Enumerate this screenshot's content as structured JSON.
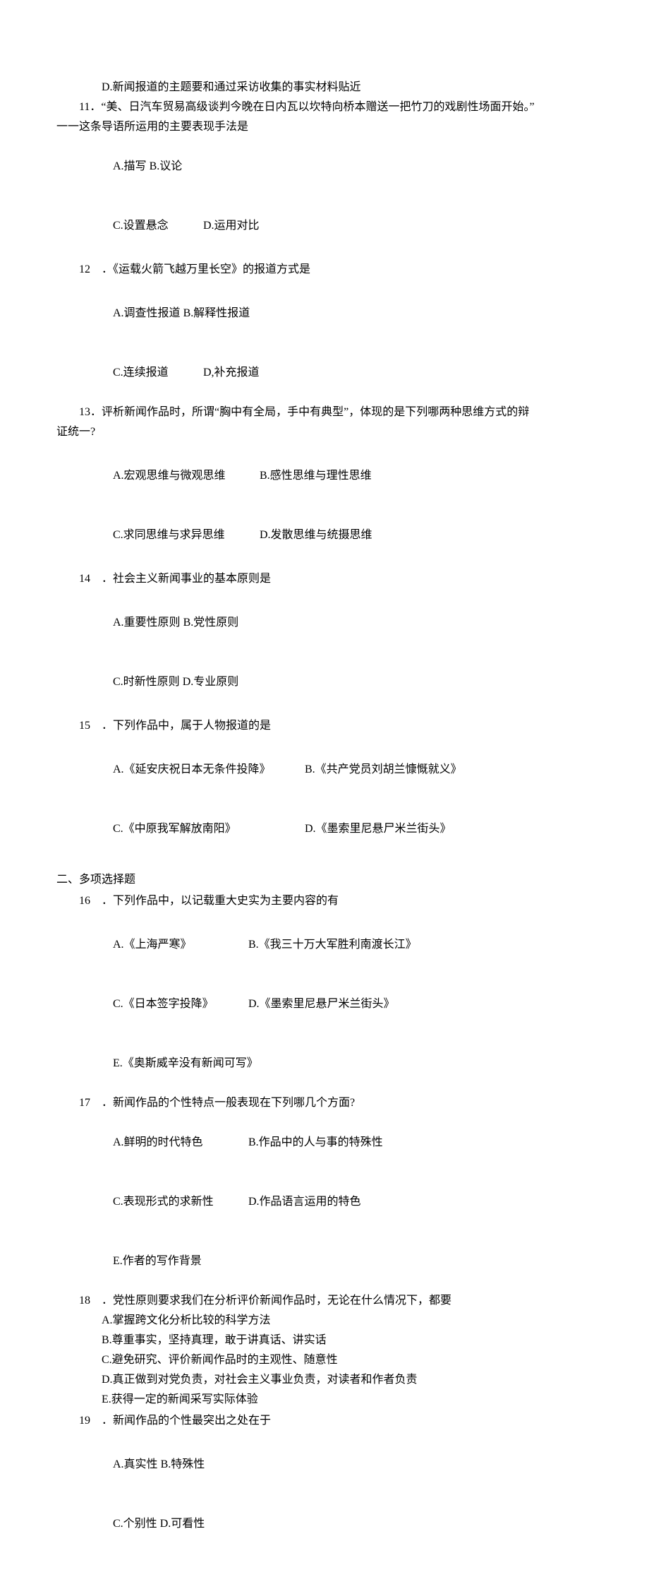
{
  "q10": {
    "optD": "D.新闻报道的主题要和通过采访收集的事实材料贴近"
  },
  "q11": {
    "num": "11",
    "stem": "．“美、日汽车贸易高级谈判今晚在日内瓦以坎特向桥本赠送一把竹刀的戏剧性场面开始。”",
    "stem2": "一一这条导语所运用的主要表现手法是",
    "optA": "A.描写",
    "optB": "B.议论",
    "optC": "C.设置悬念",
    "optD": "D.运用对比"
  },
  "q12": {
    "num": "12",
    "stem": "．《运载火箭飞越万里长空》的报道方式是",
    "optA": "A.调查性报道",
    "optB": "B.解释性报道",
    "optC": "C.连续报道",
    "optD": "D,补充报道"
  },
  "q13": {
    "num": "13",
    "stem": "．评析新闻作品时，所谓“胸中有全局，手中有典型”，体现的是下列哪两种思维方式的辩",
    "stem2": "证统一?",
    "optA": "A.宏观思维与微观思维",
    "optB": "B.感性思维与理性思维",
    "optC": "C.求同思维与求异思维",
    "optD": "D.发散思维与统摄思维"
  },
  "q14": {
    "num": "14",
    "stem": "．社会主义新闻事业的基本原则是",
    "optA": "A.重要性原则",
    "optB": "B.党性原则",
    "optC": "C.时新性原则",
    "optD": "D.专业原则"
  },
  "q15": {
    "num": "15",
    "stem": "．下列作品中，属于人物报道的是",
    "optA": "A.《延安庆祝日本无条件投降》",
    "optB": "B.《共产党员刘胡兰慷慨就义》",
    "optC": "C.《中原我军解放南阳》",
    "optD": "D.《墨索里尼悬尸米兰街头》"
  },
  "section2": "二、多项选择题",
  "q16": {
    "num": "16",
    "stem": "．下列作品中，以记载重大史实为主要内容的有",
    "optA": "A.《上海严寒》",
    "optB": "B.《我三十万大军胜利南渡长江》",
    "optC": "C.《日本签字投降》",
    "optD": "D.《墨索里尼悬尸米兰街头》",
    "optE": "E.《奥斯威辛没有新闻可写》"
  },
  "q17": {
    "num": "17",
    "stem": "．新闻作品的个性特点一般表现在下列哪几个方面?",
    "optA": "A.鲜明的时代特色",
    "optB": "B.作品中的人与事的特殊性",
    "optC": "C.表现形式的求新性",
    "optD": "D.作品语言运用的特色",
    "optE": "E.作者的写作背景"
  },
  "q18": {
    "num": "18",
    "stem": "．党性原则要求我们在分析评价新闻作品时，无论在什么情况下，都要",
    "optA": "A.掌握跨文化分析比较的科学方法",
    "optB": "B.尊重事实，坚持真理，敢于讲真话、讲实话",
    "optC": "C.避免研究、评价新闻作品时的主观性、随意性",
    "optD": "D.真正做到对党负责，对社会主义事业负责，对读者和作者负责",
    "optE": "E.获得一定的新闻采写实际体验"
  },
  "q19": {
    "num": "19",
    "stem": "．新闻作品的个性最突出之处在于",
    "optA": "A.真实性",
    "optB": "B.特殊性",
    "optC": "C.个别性",
    "optD": "D.可看性"
  }
}
